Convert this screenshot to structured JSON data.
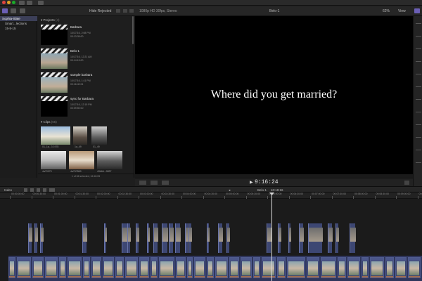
{
  "toolbar": {
    "hide_rejected": "Hide Rejected",
    "format": "1080p HD 30fps, Stereo",
    "project_name": "Belo-1",
    "zoom": "62%",
    "view": "View"
  },
  "libraries": [
    {
      "label": "Sophia-Slate",
      "selected": true
    },
    {
      "label": "Smart...lections",
      "selected": false
    },
    {
      "label": "15-5-15",
      "selected": false
    }
  ],
  "browser": {
    "projects_header": "Projects",
    "projects_count": "(4)",
    "projects": [
      {
        "name": "Barbara",
        "date": "10/17/16, 2:08 PM",
        "duration": "00:13:35:00"
      },
      {
        "name": "Belo-1",
        "date": "10/17/16, 12:21 AM",
        "duration": "00:14:15:00"
      },
      {
        "name": "sample barbara",
        "date": "10/17/16, 1:41 PM",
        "duration": "00:16:40:01"
      },
      {
        "name": "sync for Barbara",
        "date": "10/17/16, 12:15 PM",
        "duration": "00:09:50:00"
      }
    ],
    "clips_header": "Clips",
    "clips_count": "(65)",
    "clips": [
      {
        "label": "01_1a_ 3 1978"
      },
      {
        "label": "1a_49"
      },
      {
        "label": "01_49"
      },
      {
        "label": "4a70979"
      },
      {
        "label": "4a767869"
      },
      {
        "label": "49b6d...9837"
      }
    ],
    "status": "1 of 66 selected, 16:18:05"
  },
  "viewer": {
    "subtitle": "Where did you get married?",
    "timecode": "9:16:24"
  },
  "timeline": {
    "index_label": "Index",
    "project_label": "Belo-1",
    "duration": "10:18:16",
    "ruler": [
      "00:00:00:00",
      "00:00:30:00",
      "00:01:00:00",
      "00:01:30:00",
      "00:02:00:00",
      "00:02:30:00",
      "00:03:00:00",
      "00:03:30:00",
      "00:04:00:00",
      "00:04:30:00",
      "00:05:00:00",
      "00:05:30:00",
      "00:06:00:00",
      "00:06:30:00",
      "00:07:00:00",
      "00:07:30:00",
      "00:08:00:00",
      "00:08:30:00",
      "00:09:00:00",
      "00:09:30:00"
    ]
  },
  "colors": {
    "accent": "#5b66a8",
    "storyline": "#2f365c",
    "viewer_bg": "#000000"
  }
}
